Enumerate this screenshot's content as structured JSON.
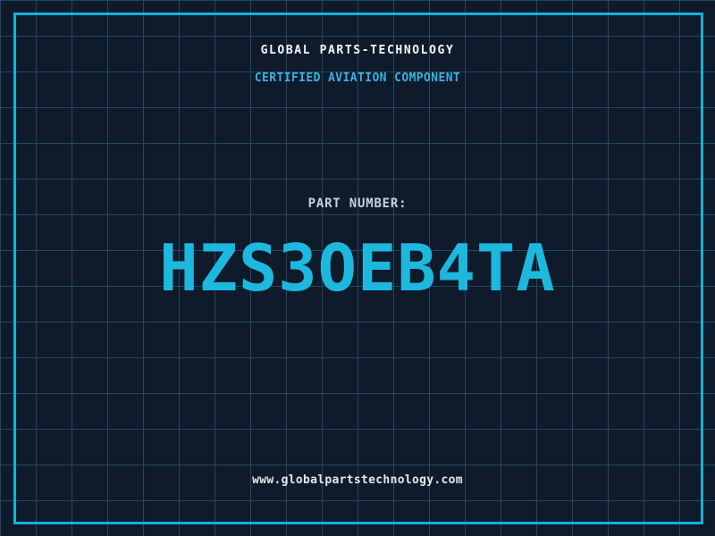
{
  "header": {
    "title": "GLOBAL PARTS-TECHNOLOGY",
    "subtitle": "CERTIFIED AVIATION COMPONENT"
  },
  "part": {
    "label": "PART NUMBER:",
    "number": "HZS3OEB4TA"
  },
  "footer": {
    "website": "www.globalpartstechnology.com"
  },
  "colors": {
    "background": "#0f1a2b",
    "grid_line": "#1e4a63",
    "border": "#12b2da",
    "title_text": "#f4f7f9",
    "subtitle_text": "#38b2e0",
    "part_label_text": "#c9d2d9",
    "part_number_text": "#1cb8de",
    "website_text": "#e3e9ec"
  }
}
